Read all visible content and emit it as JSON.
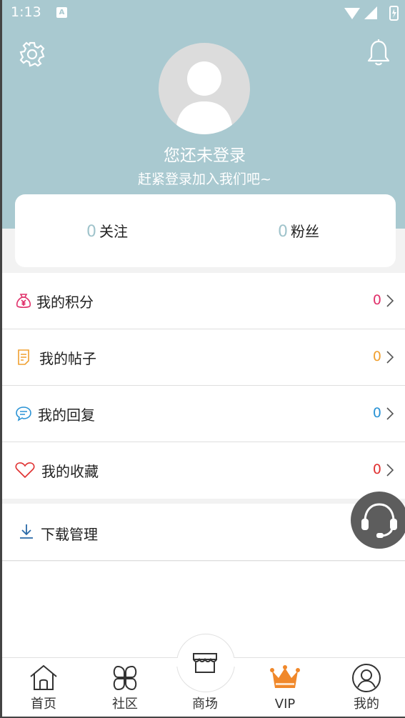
{
  "statusbar": {
    "time": "1:13",
    "notif": "A"
  },
  "header": {
    "login_title": "您还未登录",
    "login_sub": "赶紧登录加入我们吧~"
  },
  "stats": {
    "follow_count": "0",
    "follow_label": "关注",
    "fans_count": "0",
    "fans_label": "粉丝"
  },
  "menu": [
    {
      "label": "我的积分",
      "count": "0",
      "icon": "money-bag-icon",
      "color": "#e0306a"
    },
    {
      "label": "我的帖子",
      "count": "0",
      "icon": "post-icon",
      "color": "#f0a030"
    },
    {
      "label": "我的回复",
      "count": "0",
      "icon": "chat-bubble-icon",
      "color": "#2a93d5"
    },
    {
      "label": "我的收藏",
      "count": "0",
      "icon": "heart-icon",
      "color": "#e03030"
    }
  ],
  "menu2": [
    {
      "label": "下载管理",
      "icon": "download-icon",
      "color": "#2a6aa8"
    }
  ],
  "tabs": [
    {
      "label": "首页",
      "icon": "home-icon"
    },
    {
      "label": "社区",
      "icon": "community-icon"
    },
    {
      "label": "商场",
      "icon": "store-icon"
    },
    {
      "label": "VIP",
      "icon": "crown-icon"
    },
    {
      "label": "我的",
      "icon": "user-circle-icon"
    }
  ],
  "colors": {
    "header_bg": "#a9c9d0",
    "accent_vip": "#f0882a"
  }
}
